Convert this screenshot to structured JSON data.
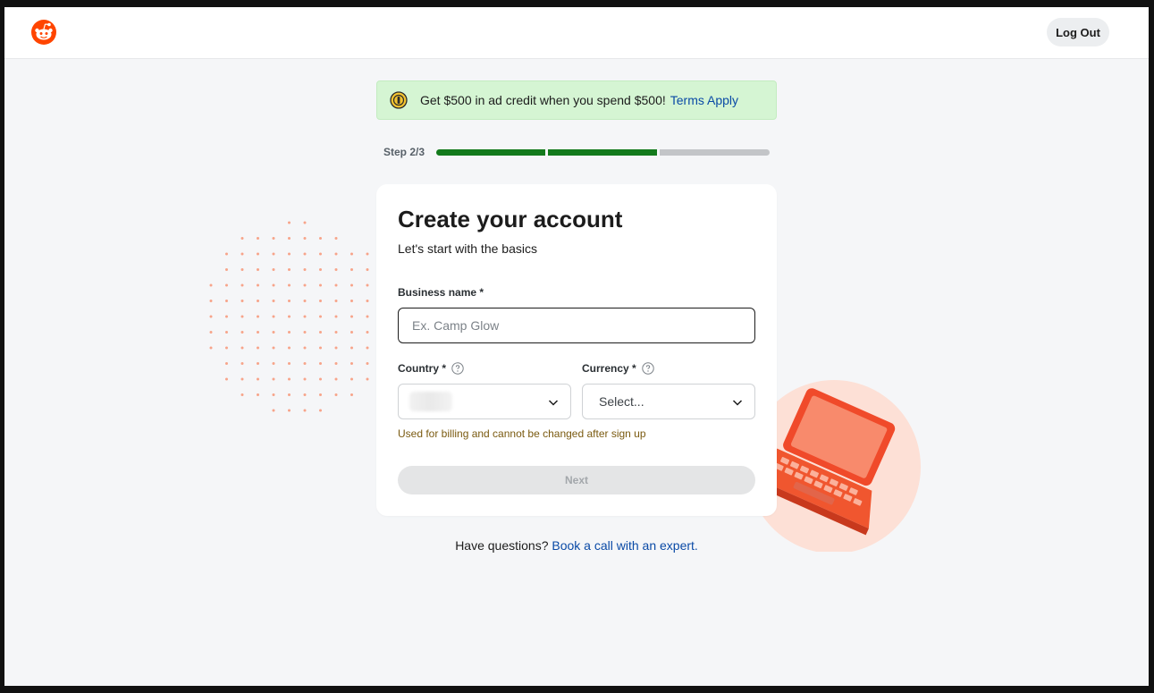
{
  "header": {
    "logo_icon": "reddit-snoo-icon",
    "logout_label": "Log Out"
  },
  "promo": {
    "icon": "coin-icon",
    "text": "Get $500 in ad credit when you spend $500!",
    "link": "Terms Apply"
  },
  "progress": {
    "label": "Step 2/3",
    "current_step": 2,
    "total_steps": 3,
    "active_color": "#137a1c",
    "inactive_color": "#c3c5c8"
  },
  "form": {
    "title": "Create your account",
    "subtitle": "Let's start with the basics",
    "business_name": {
      "label": "Business name *",
      "placeholder": "Ex. Camp Glow",
      "value": ""
    },
    "country": {
      "label": "Country *",
      "help_icon": "question-circle-icon"
    },
    "currency": {
      "label": "Currency *",
      "help_icon": "question-circle-icon",
      "placeholder": "Select..."
    },
    "hint": "Used for billing and cannot be changed after sign up",
    "next_label": "Next"
  },
  "footer": {
    "question": "Have questions?",
    "link": "Book a call with an expert."
  },
  "colors": {
    "brand": "#ff4500",
    "link": "#0a4aa6",
    "promo_bg": "#d5f5d3"
  }
}
